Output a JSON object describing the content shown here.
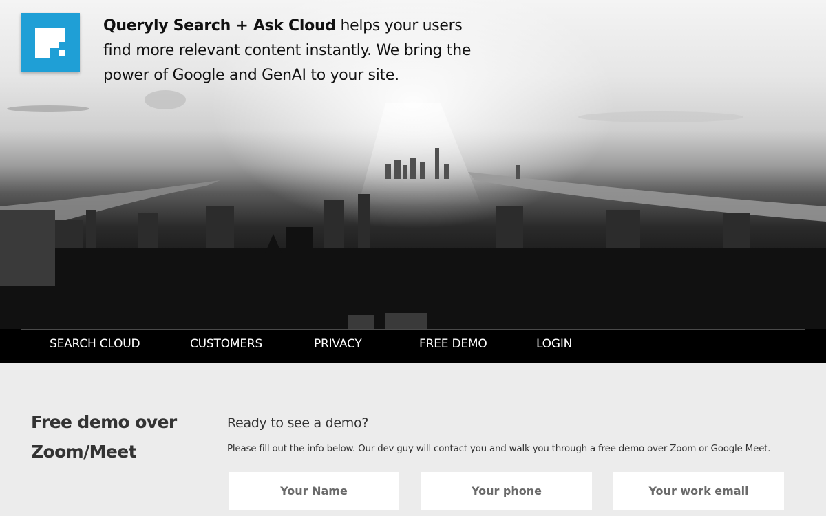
{
  "brand": {
    "logo_icon": "queryly-logo-icon",
    "accent_color": "#1f9fd6"
  },
  "hero": {
    "tagline_bold": "Queryly Search + Ask Cloud",
    "tagline_rest": " helps your users find more relevant content instantly. We bring the power of Google and GenAI to your site."
  },
  "nav": {
    "items": [
      {
        "label": "SEARCH CLOUD"
      },
      {
        "label": "CUSTOMERS"
      },
      {
        "label": "PRIVACY"
      },
      {
        "label": "FREE DEMO"
      },
      {
        "label": "LOGIN"
      }
    ]
  },
  "demo": {
    "title": "Free demo over Zoom/Meet",
    "heading": "Ready to see a demo?",
    "description": "Please fill out the info below. Our dev guy will contact you and walk you through a free demo over Zoom or Google Meet.",
    "fields": {
      "name_placeholder": "Your Name",
      "phone_placeholder": "Your phone",
      "email_placeholder": "Your work email"
    }
  }
}
